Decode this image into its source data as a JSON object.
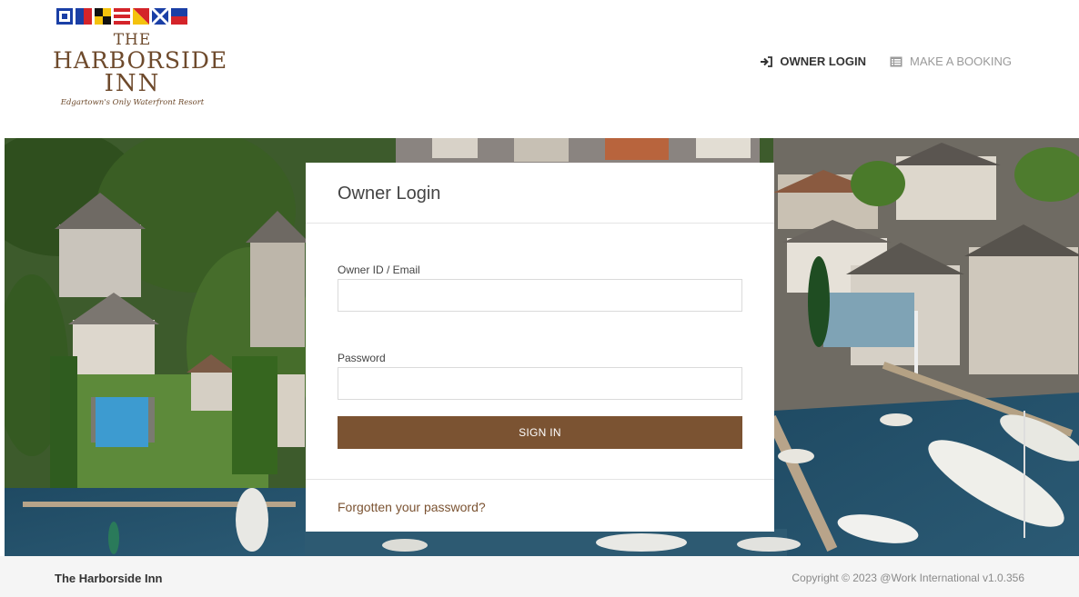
{
  "brand": {
    "the": "THE",
    "name": "HARBORSIDE",
    "inn": "INN",
    "tagline": "Edgartown's Only Waterfront Resort",
    "primary_color": "#7b5332",
    "logo_color": "#6e4a2c"
  },
  "nav": {
    "owner_login": {
      "label": "OWNER LOGIN",
      "icon": "sign-in-icon"
    },
    "make_booking": {
      "label": "MAKE A BOOKING",
      "icon": "list-icon"
    }
  },
  "login": {
    "title": "Owner Login",
    "owner_id_label": "Owner ID / Email",
    "owner_id_value": "",
    "password_label": "Password",
    "password_value": "",
    "sign_in_label": "SIGN IN",
    "forgot_label": "Forgotten your password?"
  },
  "footer": {
    "name": "The Harborside Inn",
    "copyright": "Copyright © 2023 @Work International v1.0.356"
  }
}
